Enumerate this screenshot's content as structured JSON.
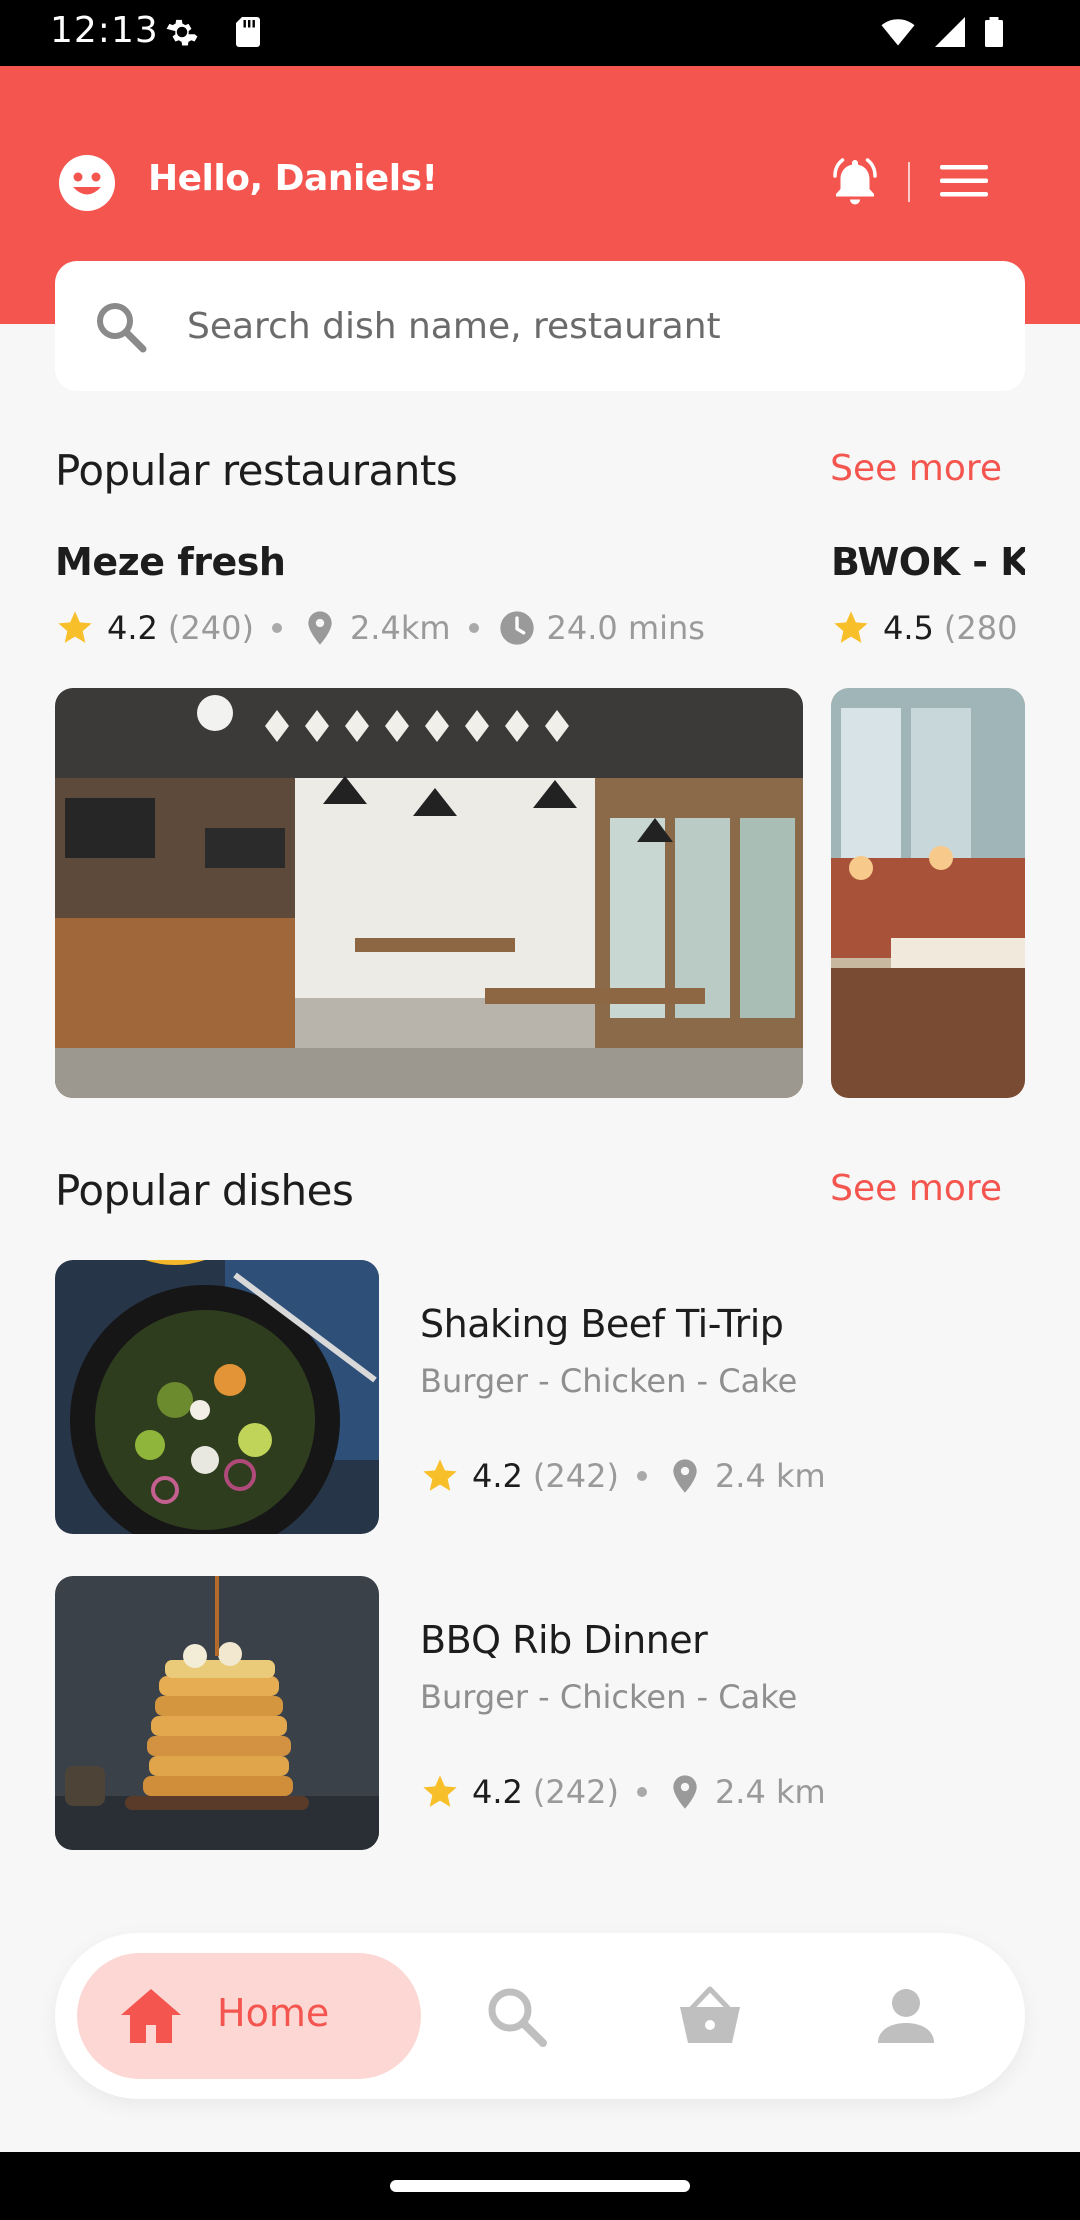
{
  "status_bar": {
    "time": "12:13"
  },
  "header": {
    "greeting": "Hello, Daniels!"
  },
  "search": {
    "placeholder": "Search dish name, restaurant"
  },
  "sections": {
    "restaurants": {
      "title": "Popular restaurants",
      "see_more": "See more"
    },
    "dishes": {
      "title": "Popular dishes",
      "see_more": "See more"
    }
  },
  "restaurants": [
    {
      "name": "Meze fresh",
      "rating": "4.2",
      "reviews": "(240)",
      "distance": "2.4km",
      "time": "24.0 mins"
    },
    {
      "name": "BWOK - Ki",
      "rating": "4.5",
      "reviews": "(280"
    }
  ],
  "dishes": [
    {
      "name": "Shaking Beef Ti-Trip",
      "categories": "Burger - Chicken - Cake",
      "rating": "4.2",
      "reviews": "(242)",
      "distance": "2.4 km"
    },
    {
      "name": "BBQ Rib Dinner",
      "categories": "Burger - Chicken - Cake",
      "rating": "4.2",
      "reviews": "(242)",
      "distance": "2.4 km"
    }
  ],
  "bottom_nav": {
    "home_label": "Home"
  },
  "icons": {
    "status": [
      "settings-icon",
      "sd-card-icon",
      "wifi-icon",
      "signal-icon",
      "battery-icon"
    ],
    "header": [
      "smile-icon",
      "bell-icon",
      "menu-icon"
    ],
    "meta": [
      "star-icon",
      "location-pin-icon",
      "clock-icon"
    ],
    "nav": [
      "home-icon",
      "search-icon",
      "basket-icon",
      "profile-icon"
    ]
  },
  "colors": {
    "brand": "#f4554f",
    "star": "#f7bf2a",
    "nav_active_bg": "#fcd7d3",
    "nav_inactive": "#bfbfbf"
  }
}
